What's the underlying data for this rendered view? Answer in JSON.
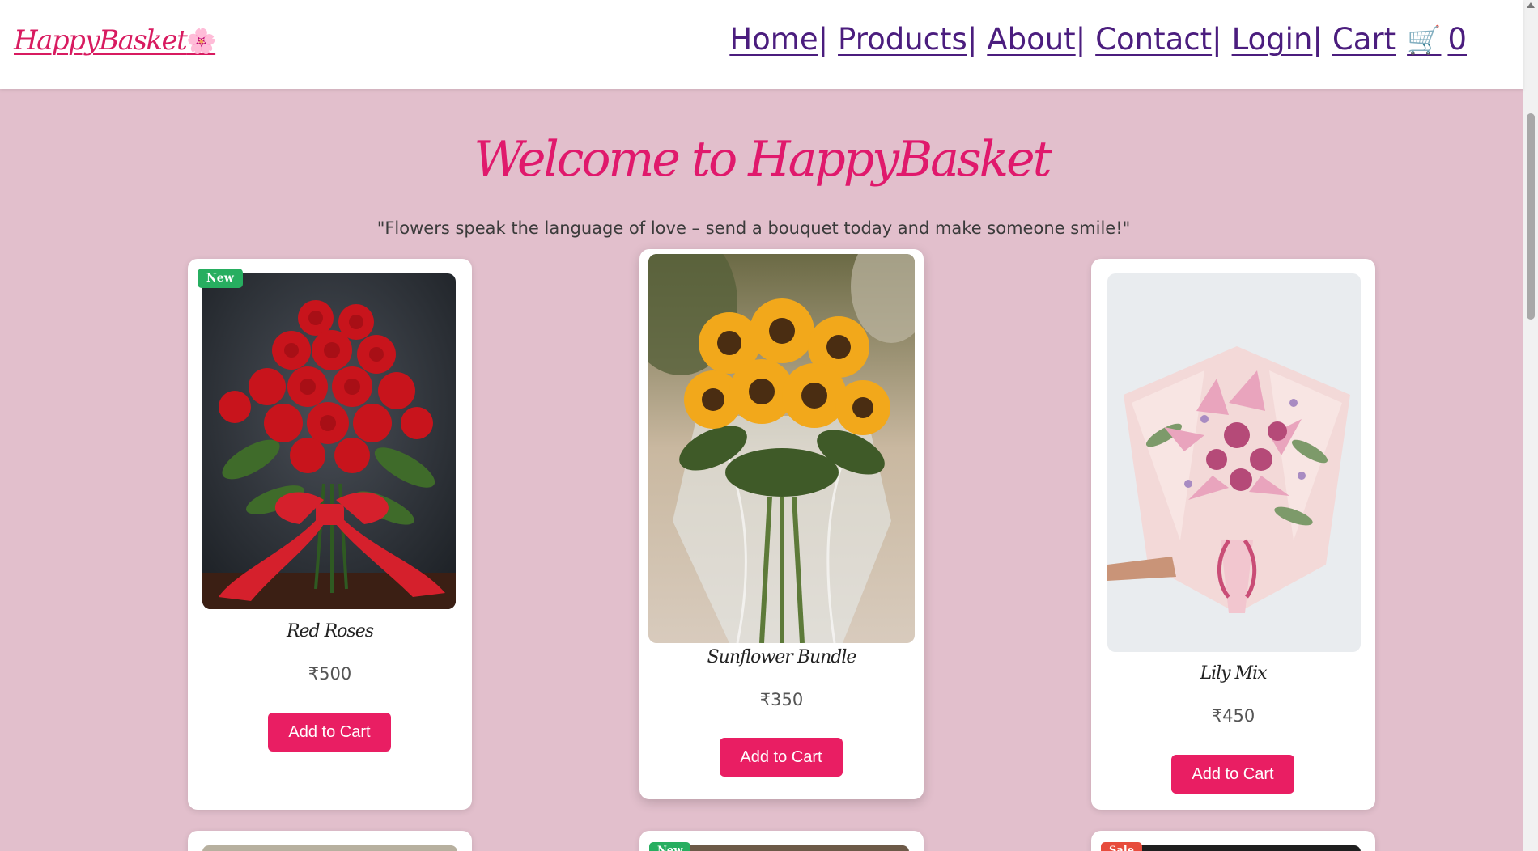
{
  "header": {
    "logo": "HappyBasket",
    "logo_icon": "cherry-blossom-icon",
    "nav": {
      "home": "Home",
      "products": "Products",
      "about": "About",
      "contact": "Contact",
      "login": "Login",
      "cart": "Cart",
      "cart_count": "0",
      "separator": "|"
    }
  },
  "hero": {
    "title": "Welcome to HappyBasket",
    "tagline": "\"Flowers speak the language of love – send a bouquet today and make someone smile!\""
  },
  "products": [
    {
      "name": "Red Roses",
      "price": "₹500",
      "badge": "New",
      "button": "Add to Cart"
    },
    {
      "name": "Sunflower Bundle",
      "price": "₹350",
      "button": "Add to Cart"
    },
    {
      "name": "Lily Mix",
      "price": "₹450",
      "button": "Add to Cart"
    }
  ],
  "row2_badges": [
    "New",
    "Sale"
  ],
  "colors": {
    "page_bg": "#e2bfcc",
    "accent": "#e91e63",
    "nav_link": "#4b1d7e",
    "badge_new": "#27ae60",
    "badge_sale": "#e74c3c"
  }
}
